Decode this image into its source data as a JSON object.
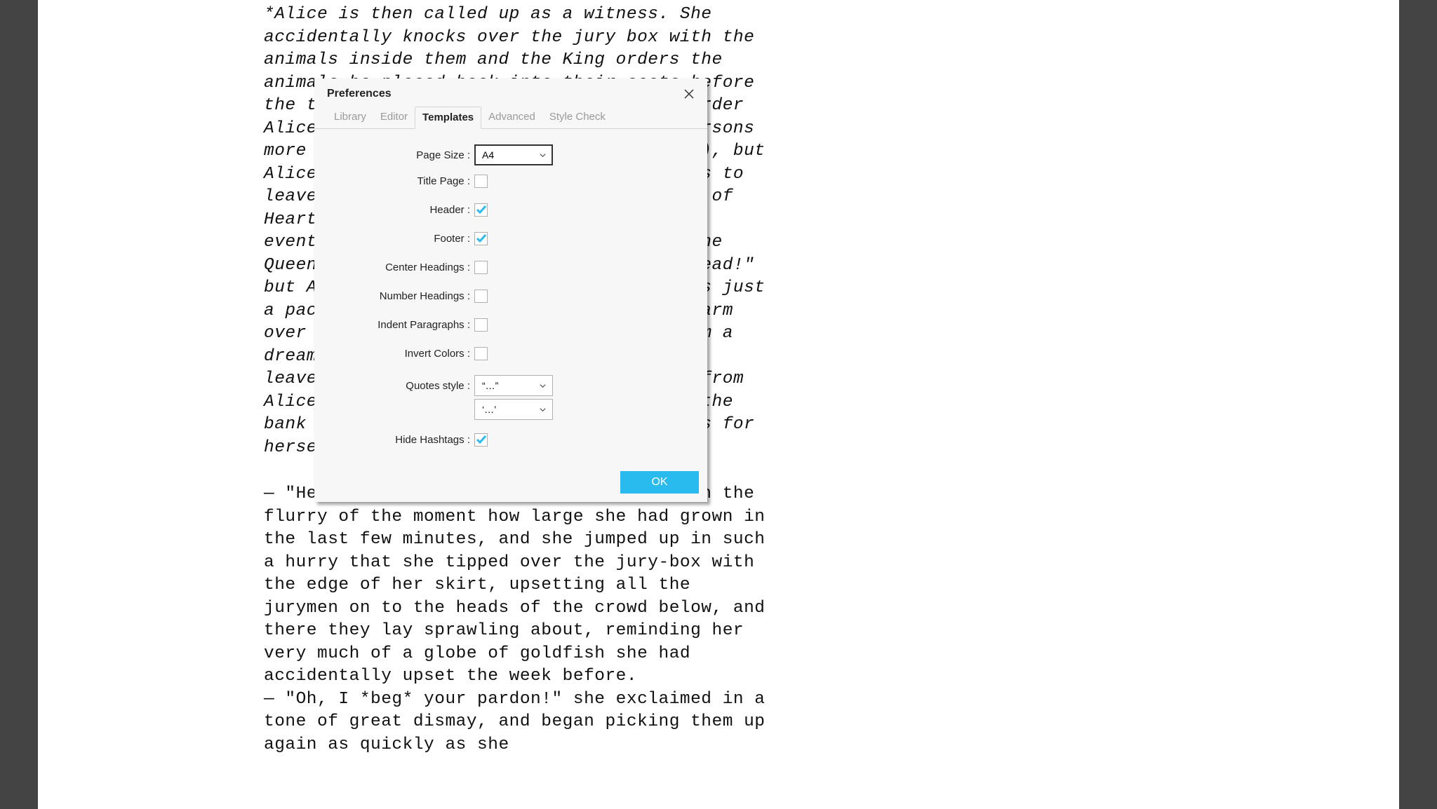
{
  "document": {
    "italic_part_prefix": "*",
    "italic_text": "Alice is then called up as a witness. She accidentally knocks over the jury box with the animals inside them and the King orders the animals be placed back into their seats before the trial continues. The King and Queen order Alice to be gone, citing Rule 42 (\"All persons more than a mile high to leave the court\"), but Alice disputes their judgement and refuses to leave. She argues with the King and Queen of Hearts over the ridiculous proceedings, eventually refusing to hold her tongue. The Queen shouts her familiar \"Off with her head!\" but Alice is unafraid, calling them out as just a pack of cards; just as they start to swarm over her. Alice's sister wakes her up from a dream, brushing what turns out to be some leaves and not a shower of playing cards from Alice's face. Alice leaves her sister on the bank to imagine all the curious happenings for herself.",
    "italic_part_suffix": "*",
    "p2": "— \"Here!\" cried Alice, quite forgetting in the flurry of the moment how large she had grown in the last few minutes, and she jumped up in such a hurry that she tipped over the jury-box with the edge of her skirt, upsetting all the jurymen on to the heads of the crowd below, and there they lay sprawling about, reminding her very much of a globe of goldfish she had accidentally upset the week before.",
    "p3": "— \"Oh, I *beg* your pardon!\" she exclaimed in a tone of great dismay, and began picking them up again as quickly as she"
  },
  "modal": {
    "title": "Preferences",
    "tabs": [
      "Library",
      "Editor",
      "Templates",
      "Advanced",
      "Style Check"
    ],
    "active_tab": "Templates",
    "fields": {
      "page_size": {
        "label": "Page Size :",
        "value": "A4"
      },
      "title_page": {
        "label": "Title Page :",
        "checked": false
      },
      "header": {
        "label": "Header :",
        "checked": true
      },
      "footer": {
        "label": "Footer :",
        "checked": true
      },
      "center_headings": {
        "label": "Center Headings :",
        "checked": false
      },
      "number_headings": {
        "label": "Number Headings :",
        "checked": false
      },
      "indent_paragraphs": {
        "label": "Indent Paragraphs :",
        "checked": false
      },
      "invert_colors": {
        "label": "Invert Colors :",
        "checked": false
      },
      "quotes_style": {
        "label": "Quotes style :",
        "value1": "“…”",
        "value2": "‘…’"
      },
      "hide_hashtags": {
        "label": "Hide Hashtags :",
        "checked": true
      }
    },
    "ok": "OK"
  }
}
